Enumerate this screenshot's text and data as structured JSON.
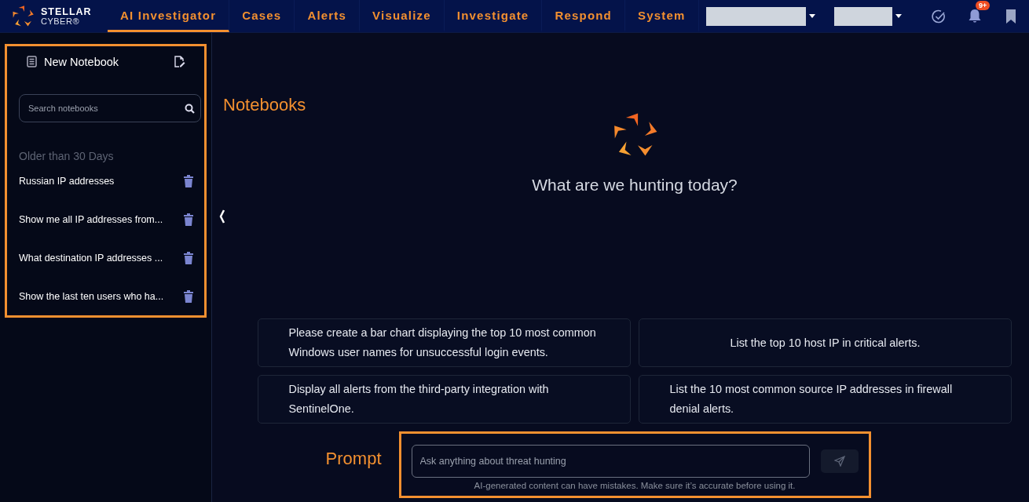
{
  "brand": {
    "name": "STELLAR",
    "sub": "CYBER®"
  },
  "nav": [
    {
      "label": "AI Investigator",
      "selected": true
    },
    {
      "label": "Cases",
      "selected": false
    },
    {
      "label": "Alerts",
      "selected": false
    },
    {
      "label": "Visualize",
      "selected": false
    },
    {
      "label": "Investigate",
      "selected": false
    },
    {
      "label": "Respond",
      "selected": false
    },
    {
      "label": "System",
      "selected": false
    }
  ],
  "notifications": {
    "badge": "9+"
  },
  "sidebar": {
    "new_button": "New Notebook",
    "search": {
      "placeholder": "Search notebooks"
    },
    "group_label": "Older than 30 Days",
    "notebooks": [
      {
        "title": "Russian IP addresses"
      },
      {
        "title": "Show me all IP addresses from..."
      },
      {
        "title": "What destination IP addresses ..."
      },
      {
        "title": "Show the last ten users who ha..."
      }
    ]
  },
  "main": {
    "callout_label": "Notebooks",
    "headline": "What are we hunting today?",
    "suggestions": [
      "Please create a bar chart displaying the top 10 most common Windows user names for unsuccessful login events.",
      "List the top 10 host IP in critical alerts.",
      "Display all alerts from the third-party integration with SentinelOne.",
      "List the 10 most common source IP addresses in firewall denial alerts."
    ]
  },
  "prompt": {
    "callout_label": "Prompt",
    "placeholder": "Ask anything about threat hunting",
    "disclaimer": "AI-generated content can have mistakes. Make sure it’s accurate before using it."
  }
}
